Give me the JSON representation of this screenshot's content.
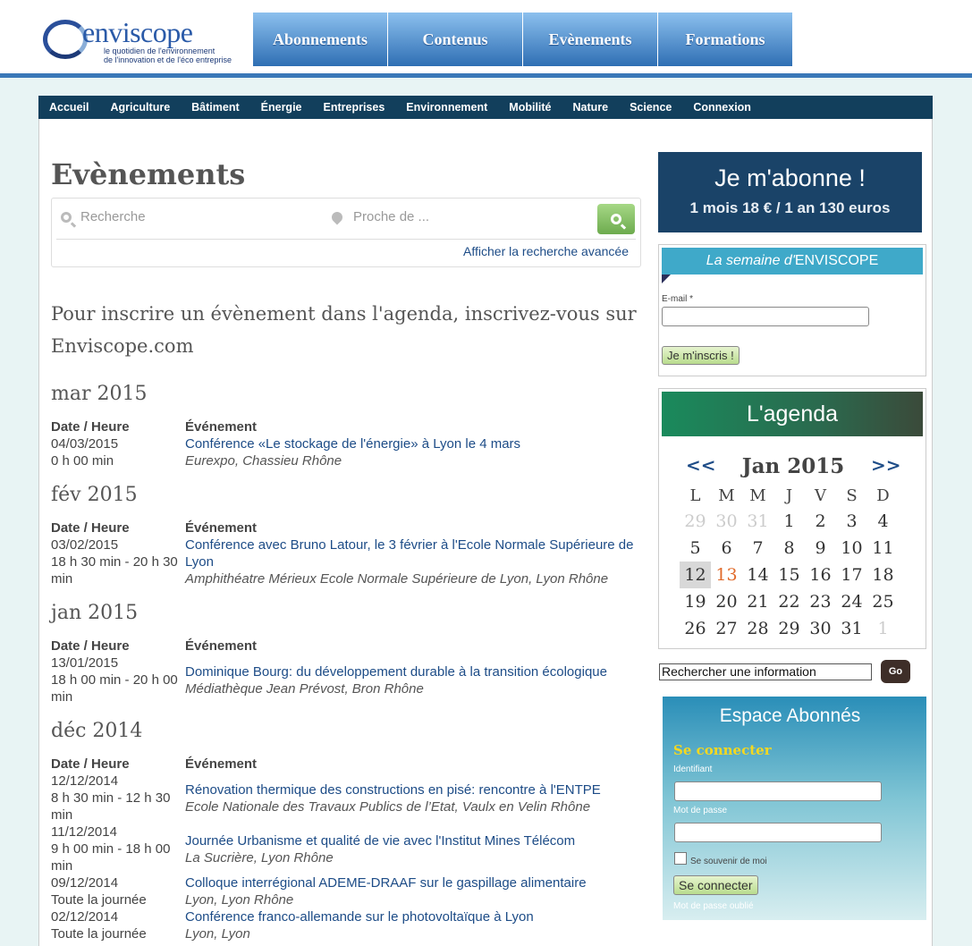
{
  "logo": {
    "name": "enviscope",
    "tag1": "le quotidien de l'environnement",
    "tag2": "de l'innovation et de l'éco entreprise"
  },
  "topnav": [
    "Abonnements",
    "Contenus",
    "Evènements",
    "Formations"
  ],
  "catnav": [
    "Accueil",
    "Agriculture",
    "Bâtiment",
    "Énergie",
    "Entreprises",
    "Environnement",
    "Mobilité",
    "Nature",
    "Science",
    "Connexion"
  ],
  "page": {
    "title": "Evènements",
    "intro": "Pour inscrire un évènement dans l'agenda, inscrivez-vous sur Enviscope.com"
  },
  "search": {
    "placeholder": "Recherche",
    "near_placeholder": "Proche de ...",
    "advanced": "Afficher la recherche avancée"
  },
  "table_headers": {
    "date": "Date / Heure",
    "event": "Événement"
  },
  "months": [
    {
      "label": "mar 2015",
      "events": [
        {
          "date": "04/03/2015",
          "time": "0 h 00 min",
          "title": "Conférence «Le stockage de l'énergie» à Lyon le 4 mars",
          "location": "Eurexpo, Chassieu Rhône"
        }
      ]
    },
    {
      "label": "fév 2015",
      "events": [
        {
          "date": "03/02/2015",
          "time": "18 h 30 min - 20 h 30 min",
          "title": "Conférence avec Bruno Latour, le 3 février à l'Ecole Normale Supérieure de Lyon",
          "location": "Amphithéatre Mérieux Ecole Normale Supérieure de Lyon, Lyon Rhône"
        }
      ]
    },
    {
      "label": "jan 2015",
      "events": [
        {
          "date": "13/01/2015",
          "time": "18 h 00 min - 20 h 00 min",
          "title": "Dominique Bourg: du développement durable à la transition écologique",
          "location": "Médiathèque Jean Prévost, Bron Rhône"
        }
      ]
    },
    {
      "label": "déc 2014",
      "events": [
        {
          "date": "12/12/2014",
          "time": "8 h 30 min - 12 h 30 min",
          "title": "Rénovation thermique des constructions en pisé: rencontre à l'ENTPE",
          "location": "Ecole Nationale des Travaux Publics de l’Etat, Vaulx en Velin Rhône"
        },
        {
          "date": "11/12/2014",
          "time": "9 h 00 min - 18 h 00 min",
          "title": "Journée Urbanisme et qualité de vie avec l'Institut Mines Télécom",
          "location": "La Sucrière, Lyon Rhône"
        },
        {
          "date": "09/12/2014",
          "time": "Toute la journée",
          "title": "Colloque interrégional ADEME-DRAAF sur le gaspillage alimentaire",
          "location": "Lyon, Lyon Rhône"
        },
        {
          "date": "02/12/2014",
          "time": "Toute la journée",
          "title": "Conférence franco-allemande sur le photovoltaïque à Lyon",
          "location": "Lyon, Lyon"
        }
      ]
    }
  ],
  "subscribe": {
    "title": "Je m'abonne !",
    "price": "1 mois 18 € / 1 an 130 euros"
  },
  "newsletter": {
    "title_italic": "La semaine d'",
    "title_rest": "ENVISCOPE",
    "email_label": "E-mail *",
    "button": "Je m'inscris !"
  },
  "agenda": {
    "title": "L'agenda",
    "prev": "<<",
    "next": ">>",
    "month": "Jan 2015",
    "weekdays": [
      "L",
      "M",
      "M",
      "J",
      "V",
      "S",
      "D"
    ],
    "weeks": [
      [
        "29",
        "30",
        "31",
        "1",
        "2",
        "3",
        "4"
      ],
      [
        "5",
        "6",
        "7",
        "8",
        "9",
        "10",
        "11"
      ],
      [
        "12",
        "13",
        "14",
        "15",
        "16",
        "17",
        "18"
      ],
      [
        "19",
        "20",
        "21",
        "22",
        "23",
        "24",
        "25"
      ],
      [
        "26",
        "27",
        "28",
        "29",
        "30",
        "31",
        "1"
      ]
    ]
  },
  "site_search": {
    "value": "Rechercher une information",
    "button": "Go"
  },
  "member": {
    "title": "Espace Abonnés",
    "connect": "Se connecter",
    "id_label": "Identifiant",
    "pw_label": "Mot de passe",
    "remember": "Se souvenir de moi",
    "button": "Se connecter",
    "forgot": "Mot de passe oublié"
  }
}
